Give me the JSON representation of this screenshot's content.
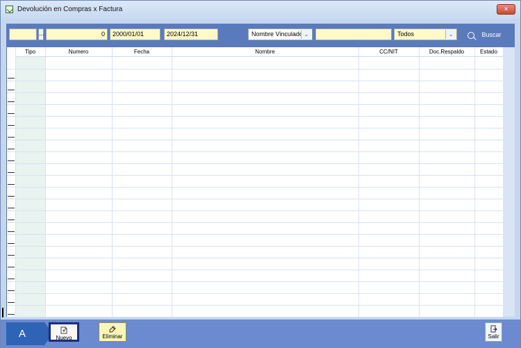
{
  "window": {
    "title": "Devolución en Compras x Factura",
    "close_label": "×"
  },
  "filters": {
    "code": "",
    "browse_label": "...",
    "number": "0",
    "date_from": "2000/01/01",
    "date_to": "2024/12/31",
    "linked_type": "Nombre Vinculado",
    "linked_value": "",
    "status": "Todos",
    "search_label": "Buscar"
  },
  "table": {
    "columns": [
      "Tipo",
      "Numero",
      "Fecha",
      "Nombre",
      "CC/NIT",
      "Doc.Respaldo",
      "Estado"
    ],
    "rows": []
  },
  "footer": {
    "tab_label": "A",
    "new_label": "Nuevo",
    "delete_label": "Eliminar",
    "exit_label": "Salir"
  },
  "colors": {
    "main_blue": "#5a7bbb",
    "footer_blue": "#6b8ad0",
    "field_yellow": "#fff9c9"
  }
}
